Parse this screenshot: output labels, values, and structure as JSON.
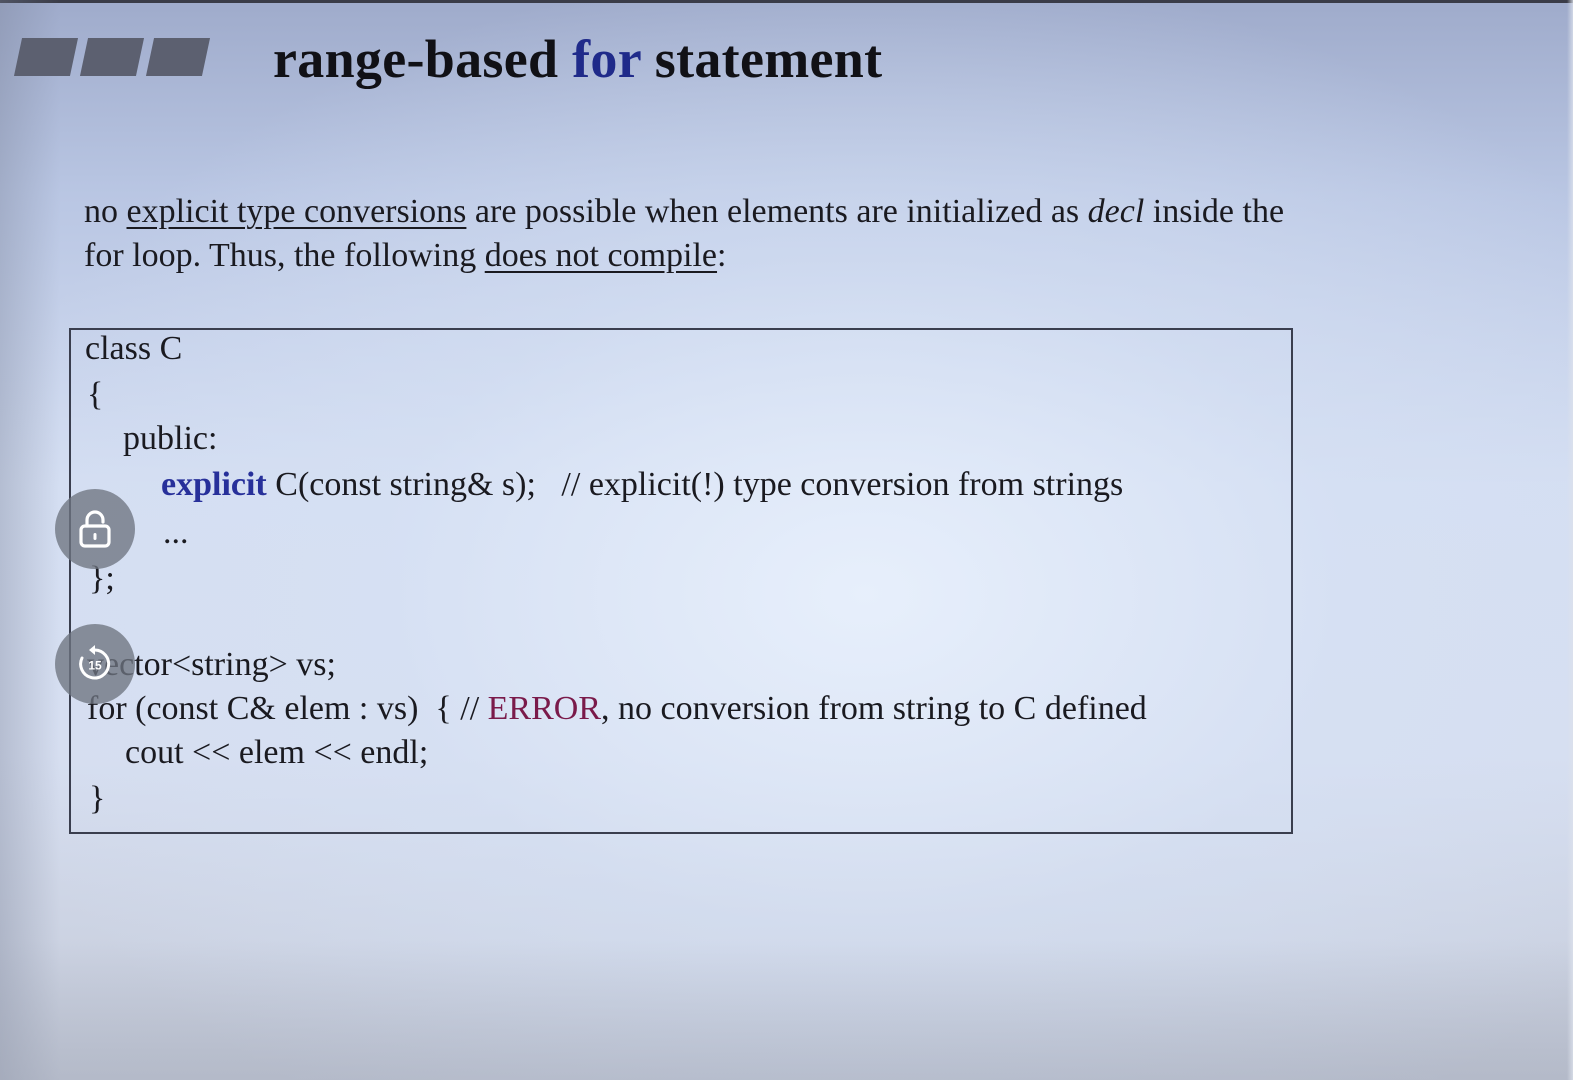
{
  "slide": {
    "title": {
      "before": "range-based ",
      "keyword": "for",
      "after": " statement"
    },
    "paragraph": {
      "t1": "no ",
      "t2": "explicit type conversions",
      "t3": " are possible when elements are initialized as ",
      "t4": "decl",
      "t5": " inside the",
      "t6": "for loop. Thus, the following ",
      "t7": "does not compile",
      "t8": ":"
    },
    "code": {
      "l1": "class C",
      "l2": "{",
      "l3": "public:",
      "l4_kw": "explicit",
      "l4_rest": " C(const string& s);   // explicit(!) type conversion from strings",
      "l5": "...",
      "l6": "};",
      "l7": "vector<string> vs;",
      "l8_a": "for (const C& elem : vs)  { // ",
      "l8_err": "ERROR",
      "l8_b": ", no conversion from string to C defined",
      "l9": "cout << elem << endl;",
      "l10": "}"
    }
  },
  "controls": {
    "lock_icon": "lock-open-icon",
    "replay_icon": "replay-15-icon",
    "replay_seconds": "15"
  },
  "colors": {
    "keyword": "#1f2a8a",
    "error": "#7a1a4a",
    "control_bg": "#6e7480"
  }
}
